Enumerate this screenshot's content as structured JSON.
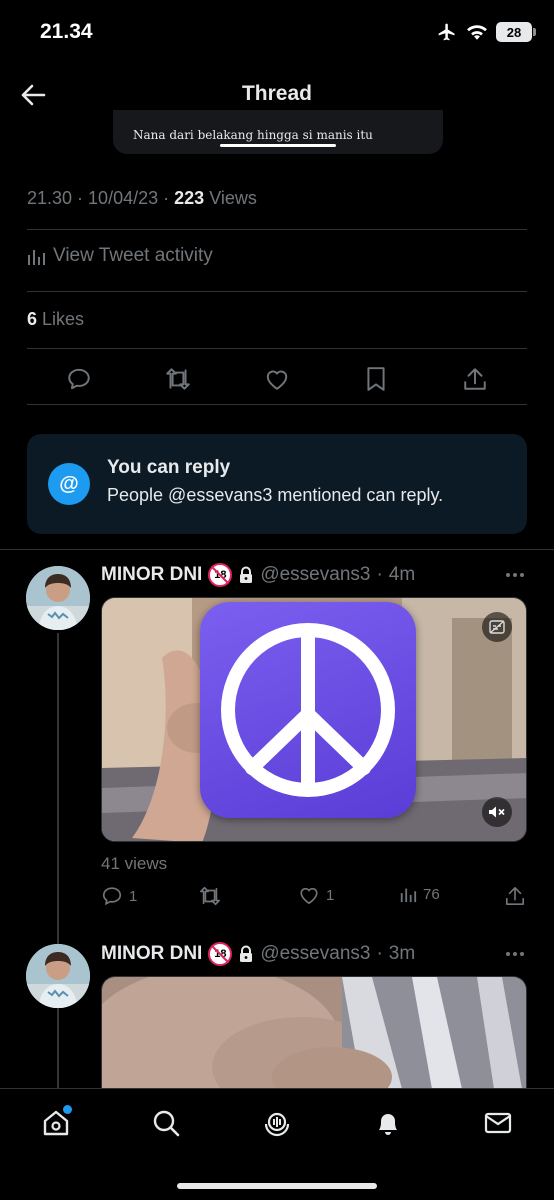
{
  "status_bar": {
    "time": "21.34",
    "battery": "28"
  },
  "nav": {
    "title": "Thread"
  },
  "caption": {
    "text": "Nana dari belakang hingga si manis itu"
  },
  "tweet_meta": {
    "time": "21.30",
    "date": "10/04/23",
    "views_count": "223",
    "views_label": "Views"
  },
  "activity": {
    "label": "View Tweet activity"
  },
  "likes": {
    "count": "6",
    "label": "Likes"
  },
  "reply_notice": {
    "title": "You can reply",
    "text": "People @essevans3 mentioned can reply."
  },
  "tweets": [
    {
      "author": "MINOR DNI",
      "age_badge": "18",
      "handle": "@essevans3",
      "age": "4m",
      "views_text": "41 views",
      "replies": "1",
      "likes": "1",
      "view_count": "76"
    },
    {
      "author": "MINOR DNI",
      "age_badge": "18",
      "handle": "@essevans3",
      "age": "3m"
    }
  ],
  "tabs": [
    "home-icon",
    "search-icon",
    "spaces-icon",
    "notifications-icon",
    "messages-icon"
  ],
  "colors": {
    "accent": "#1d9bf0",
    "background": "#000000",
    "muted": "#71767b",
    "reply_card": "#0c1a26",
    "peace_icon": "#6a4ce6"
  }
}
